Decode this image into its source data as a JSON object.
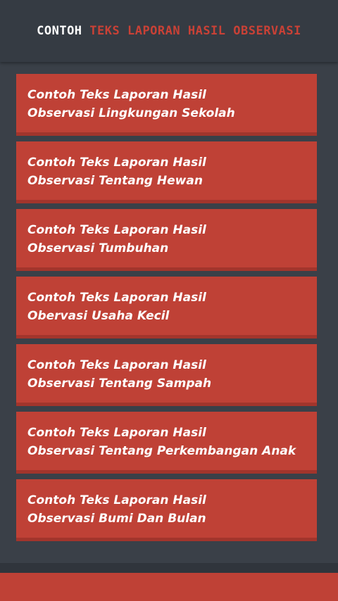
{
  "header": {
    "title_part1": "CONTOH",
    "title_part2": "TEKS LAPORAN HASIL OBSERVASI"
  },
  "items": [
    {
      "line1": "Contoh Teks Laporan Hasil",
      "line2": "Observasi Lingkungan Sekolah"
    },
    {
      "line1": "Contoh Teks Laporan Hasil",
      "line2": "Observasi Tentang Hewan"
    },
    {
      "line1": "Contoh Teks Laporan Hasil",
      "line2": "Observasi Tumbuhan"
    },
    {
      "line1": "Contoh Teks Laporan Hasil",
      "line2": "Obervasi Usaha Kecil"
    },
    {
      "line1": "Contoh Teks Laporan Hasil",
      "line2": "Observasi Tentang Sampah"
    },
    {
      "line1": "Contoh Teks Laporan Hasil",
      "line2": "Observasi Tentang Perkembangan Anak"
    },
    {
      "line1": "Contoh Teks Laporan Hasil",
      "line2": "Observasi Bumi Dan Bulan"
    }
  ],
  "colors": {
    "background": "#3a4048",
    "header": "#353b43",
    "card": "#bf4136",
    "accent": "#c94136"
  }
}
